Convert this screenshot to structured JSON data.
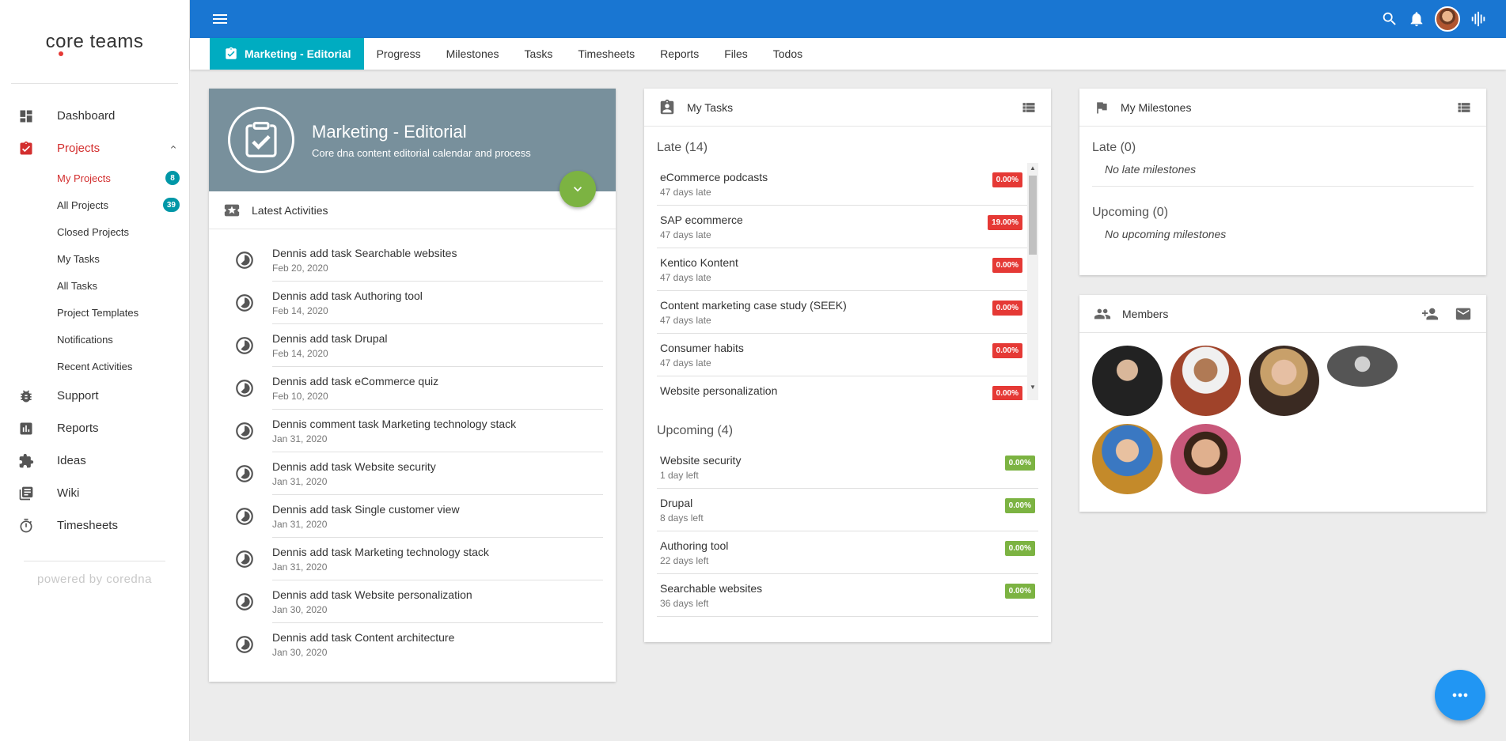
{
  "app": {
    "logo_left": "c",
    "logo_o": "o",
    "logo_right": "re teams",
    "powered": "powered by coredna"
  },
  "sidebar": {
    "items": [
      {
        "label": "Dashboard",
        "icon": "dashboard-icon"
      },
      {
        "label": "Projects",
        "icon": "projects-icon"
      },
      {
        "label": "Support",
        "icon": "bug-icon"
      },
      {
        "label": "Reports",
        "icon": "reports-icon"
      },
      {
        "label": "Ideas",
        "icon": "puzzle-icon"
      },
      {
        "label": "Wiki",
        "icon": "wiki-icon"
      },
      {
        "label": "Timesheets",
        "icon": "stopwatch-icon"
      }
    ],
    "sub_items": [
      {
        "label": "My Projects",
        "badge": "8"
      },
      {
        "label": "All Projects",
        "badge": "39"
      },
      {
        "label": "Closed Projects"
      },
      {
        "label": "My Tasks"
      },
      {
        "label": "All Tasks"
      },
      {
        "label": "Project Templates"
      },
      {
        "label": "Notifications"
      },
      {
        "label": "Recent Activities"
      }
    ]
  },
  "tabs": [
    "Marketing - Editorial",
    "Progress",
    "Milestones",
    "Tasks",
    "Timesheets",
    "Reports",
    "Files",
    "Todos"
  ],
  "project": {
    "title": "Marketing - Editorial",
    "subtitle": "Core dna content editorial calendar and process",
    "activities_title": "Latest Activities",
    "activities": [
      {
        "text": "Dennis add task Searchable websites",
        "date": "Feb 20, 2020"
      },
      {
        "text": "Dennis add task Authoring tool",
        "date": "Feb 14, 2020"
      },
      {
        "text": "Dennis add task Drupal",
        "date": "Feb 14, 2020"
      },
      {
        "text": "Dennis add task eCommerce quiz",
        "date": "Feb 10, 2020"
      },
      {
        "text": "Dennis comment task Marketing technology stack",
        "date": "Jan 31, 2020"
      },
      {
        "text": "Dennis add task Website security",
        "date": "Jan 31, 2020"
      },
      {
        "text": "Dennis add task Single customer view",
        "date": "Jan 31, 2020"
      },
      {
        "text": "Dennis add task Marketing technology stack",
        "date": "Jan 31, 2020"
      },
      {
        "text": "Dennis add task Website personalization",
        "date": "Jan 30, 2020"
      },
      {
        "text": "Dennis add task Content architecture",
        "date": "Jan 30, 2020"
      }
    ]
  },
  "tasks": {
    "title": "My Tasks",
    "late_title": "Late (14)",
    "late": [
      {
        "name": "eCommerce podcasts",
        "due": "47 days late",
        "pct": "0.00%"
      },
      {
        "name": "SAP ecommerce",
        "due": "47 days late",
        "pct": "19.00%"
      },
      {
        "name": "Kentico Kontent",
        "due": "47 days late",
        "pct": "0.00%"
      },
      {
        "name": "Content marketing case study (SEEK)",
        "due": "47 days late",
        "pct": "0.00%"
      },
      {
        "name": "Consumer habits",
        "due": "47 days late",
        "pct": "0.00%"
      },
      {
        "name": "Website personalization",
        "due": "",
        "pct": "0.00%"
      }
    ],
    "upcoming_title": "Upcoming (4)",
    "upcoming": [
      {
        "name": "Website security",
        "due": "1 day left",
        "pct": "0.00%"
      },
      {
        "name": "Drupal",
        "due": "8 days left",
        "pct": "0.00%"
      },
      {
        "name": "Authoring tool",
        "due": "22 days left",
        "pct": "0.00%"
      },
      {
        "name": "Searchable websites",
        "due": "36 days left",
        "pct": "0.00%"
      }
    ]
  },
  "milestones": {
    "title": "My Milestones",
    "late_title": "Late (0)",
    "late_empty": "No late milestones",
    "upcoming_title": "Upcoming (0)",
    "upcoming_empty": "No upcoming milestones"
  },
  "members": {
    "title": "Members"
  },
  "colors": {
    "topbar": "#1976d2",
    "active_tab": "#00acc1",
    "late": "#e53935",
    "ontrack": "#7cb342",
    "accent": "#d32f2f"
  }
}
